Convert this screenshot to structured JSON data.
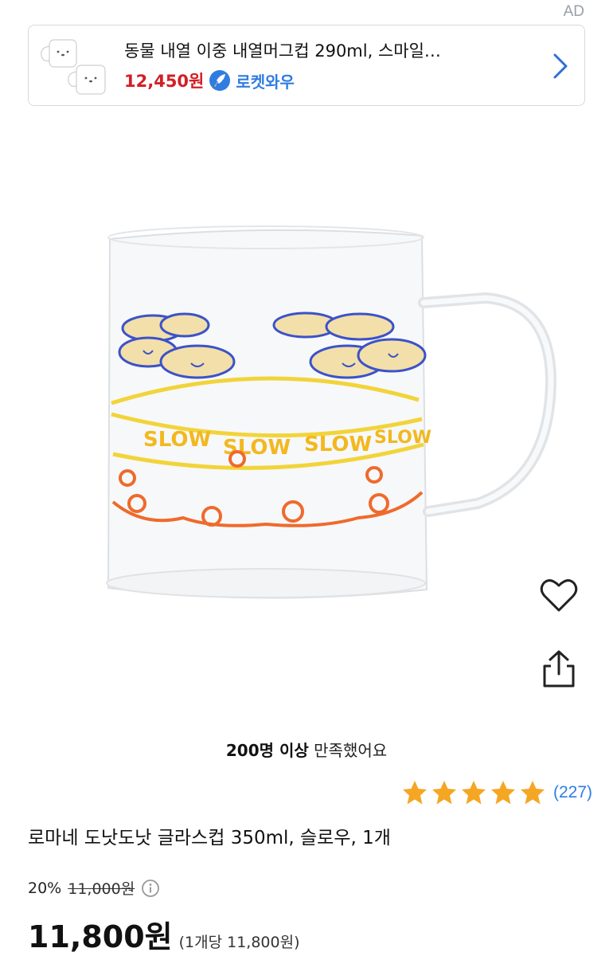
{
  "ad": {
    "label": "AD",
    "title": "동물 내열 이중 내열머그컵 290ml, 스마일…",
    "price": "12,450원",
    "badge": "로켓와우"
  },
  "rating": {
    "satisfaction_bold": "200명 이상",
    "satisfaction_text": " 만족했어요",
    "stars": 5,
    "review_count": "(227)"
  },
  "product": {
    "title": "로마네 도낫도낫 글라스컵 350ml, 슬로우, 1개",
    "discount_rate": "20%",
    "original_price": "11,000원",
    "final_price": "11,800원",
    "unit_price": "(1개당 11,800원)"
  },
  "mug_print_text": "SLOW",
  "colors": {
    "price_red": "#d21f26",
    "link_blue": "#2f7de1",
    "star_gold": "#f5a623",
    "print_yellow": "#f2d43a",
    "print_orange": "#ef6a2c",
    "print_blue": "#3b52c9"
  },
  "icons": [
    "chevron-right-icon",
    "rocket-icon",
    "heart-icon",
    "share-icon",
    "star-icon",
    "info-icon"
  ]
}
